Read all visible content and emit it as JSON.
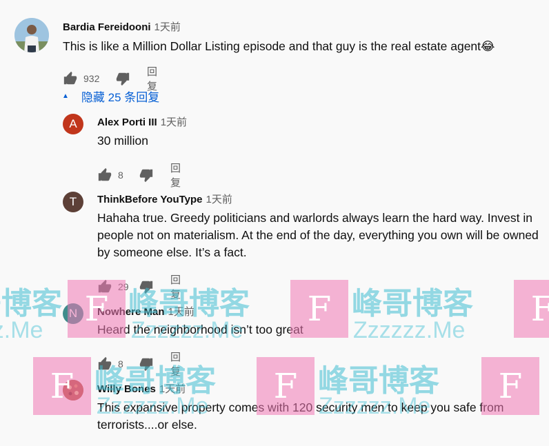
{
  "comment": {
    "author": "Bardia Fereidooni",
    "time": "1天前",
    "text": "This is like a Million Dollar Listing episode and that guy is the real estate agent😂",
    "likes": "932",
    "reply_label": "回复"
  },
  "replies_toggle": {
    "label": "隐藏 25 条回复",
    "icon": "caret-up-icon"
  },
  "replies": [
    {
      "initial": "A",
      "avatar_color": "#c1361c",
      "author": "Alex Porti III",
      "time": "1天前",
      "text": "30 million",
      "likes": "8",
      "reply_label": "回复"
    },
    {
      "initial": "T",
      "avatar_color": "#5d4037",
      "author": "ThinkBefore YouType",
      "time": "1天前",
      "text": "Hahaha true. Greedy politicians and warlords always learn the hard way. Invest in people not on materialism. At the end of the day, everything you own will be owned by someone else. It’s a fact.",
      "likes": "29",
      "reply_label": "回复"
    },
    {
      "initial": "N",
      "avatar_color": "#3f8c8c",
      "author": "Nowhere Man",
      "time": "1天前",
      "text": "Heard the neighborhood isn’t too great",
      "likes": "8",
      "reply_label": "回复"
    },
    {
      "initial": "",
      "avatar_color": "#a0402a",
      "author": "Willy Bones",
      "time": "1天前",
      "text": "This expansive property comes with 120 security men to keep you safe from terrorists....or else.",
      "likes": "",
      "reply_label": ""
    }
  ],
  "watermark": {
    "cn": "峰哥博客",
    "en": "Zzzzzz.Me",
    "logo": "F"
  },
  "colors": {
    "link": "#065fd4",
    "secondary": "#606060",
    "background": "#f9f9f9"
  }
}
